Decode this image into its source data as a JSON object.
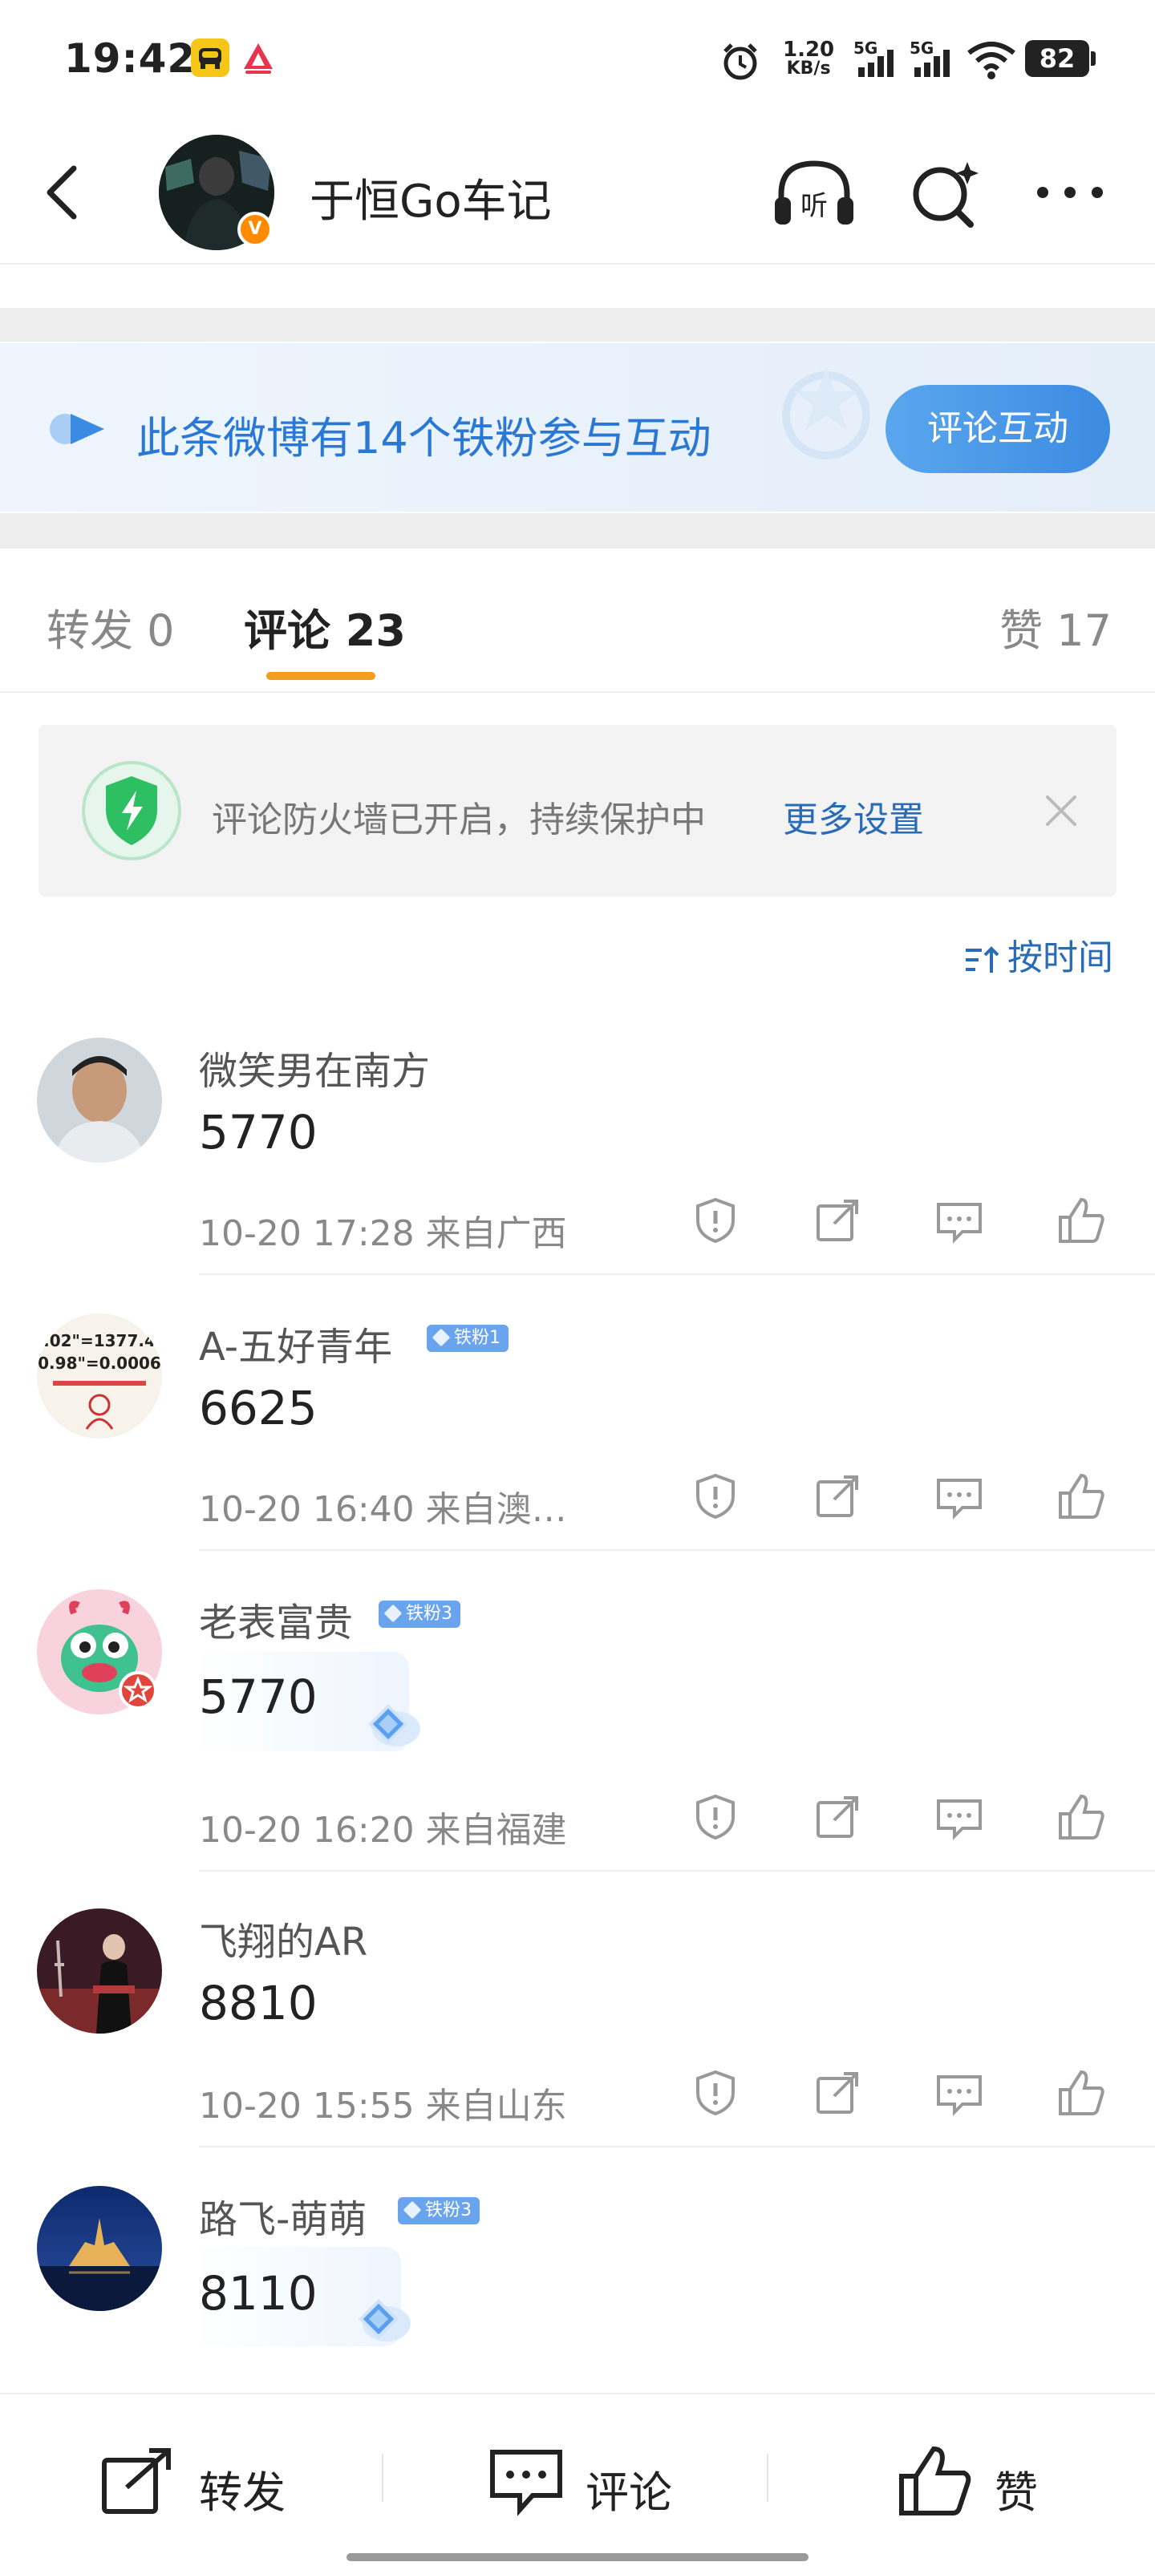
{
  "status_bar": {
    "time": "19:42",
    "net_speed_value": "1.20",
    "net_speed_unit": "KB/s",
    "signal1": "5G",
    "signal2": "5G",
    "battery": "82"
  },
  "header": {
    "title": "于恒Go车记",
    "verified_mark": "V"
  },
  "fan_banner": {
    "text": "此条微博有14个铁粉参与互动",
    "button": "评论互动"
  },
  "tabs": {
    "repost": "转发 0",
    "comment": "评论 23",
    "like": "赞 17"
  },
  "firewall": {
    "text": "评论防火墙已开启，持续保护中",
    "link": "更多设置"
  },
  "sort": {
    "label": "按时间"
  },
  "comments": [
    {
      "name": "微笑男在南方",
      "text": "5770",
      "time": "10-20 17:28",
      "location": "来自广西"
    },
    {
      "name": "A-五好青年",
      "fan_tag": "铁粉1",
      "text": "6625",
      "time": "10-20 16:40",
      "location": "来自澳…",
      "avatar_line1": ".02\"=1377.4",
      "avatar_line2": "0.98\"=0.0006"
    },
    {
      "name": "老表富贵",
      "fan_tag": "铁粉3",
      "text": "5770",
      "time": "10-20 16:20",
      "location": "来自福建"
    },
    {
      "name": "飞翔的AR",
      "text": "8810",
      "time": "10-20 15:55",
      "location": "来自山东"
    },
    {
      "name": "路飞-萌萌",
      "fan_tag": "铁粉3",
      "text": "8110"
    }
  ],
  "bottom_bar": {
    "repost": "转发",
    "comment": "评论",
    "like": "赞"
  },
  "colors": {
    "accent_blue": "#2a78d6",
    "tab_indicator": "#f29e1c",
    "fan_tag": "#6aa4ef",
    "verified": "#ff8a00"
  }
}
